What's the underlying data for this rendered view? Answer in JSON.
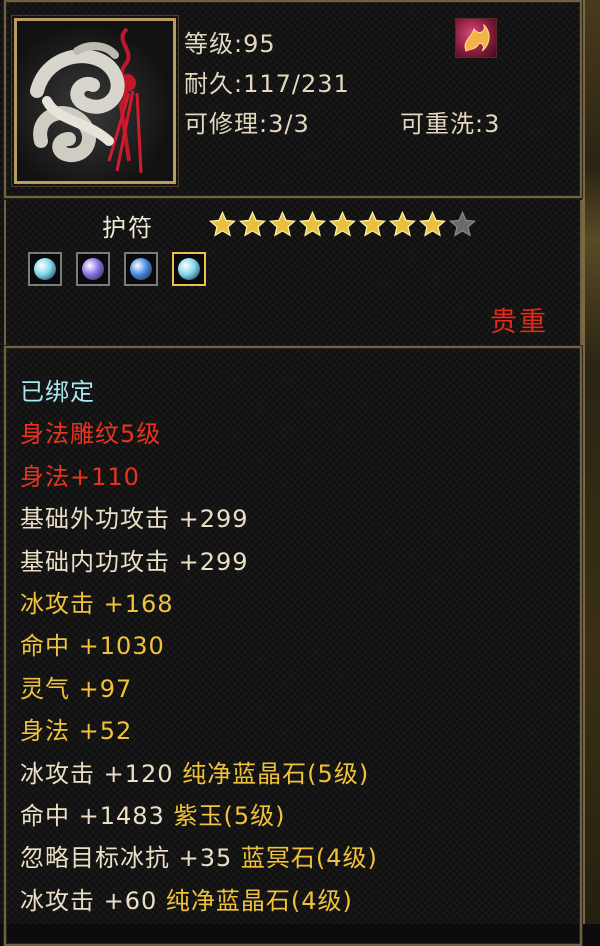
{
  "header": {
    "level": "等级:95",
    "durability": "耐久:117/231",
    "repairable": "可修理:3/3",
    "rewash": "可重洗:3"
  },
  "item": {
    "name": "护符",
    "stars_filled": 8,
    "stars_total": 9,
    "rarity": "贵重",
    "badge_icon": "flame-icon",
    "portrait_icon": "jade-amulet-icon"
  },
  "gems": [
    {
      "icon": "cyan-gem-icon",
      "color": "#7fd6e8",
      "selected": false
    },
    {
      "icon": "purple-gem-icon",
      "color": "#8a70e0",
      "selected": false
    },
    {
      "icon": "blue-gem-icon",
      "color": "#4a88e0",
      "selected": false
    },
    {
      "icon": "cyan-gem-icon",
      "color": "#7fd6e8",
      "selected": true
    }
  ],
  "attributes": [
    {
      "text": "已绑定",
      "style": "bound"
    },
    {
      "text": "身法雕纹5级",
      "style": "red"
    },
    {
      "text": "身法+110",
      "style": "red"
    },
    {
      "text": "基础外功攻击 +299",
      "style": "base"
    },
    {
      "text": "基础内功攻击 +299",
      "style": "base"
    },
    {
      "text": "冰攻击 +168",
      "style": "gold"
    },
    {
      "text": "命中 +1030",
      "style": "gold"
    },
    {
      "text": "灵气 +97",
      "style": "gold"
    },
    {
      "text": "身法 +52",
      "style": "gold"
    }
  ],
  "gem_attributes": [
    {
      "stat": "冰攻击 +120 ",
      "gem": "纯净蓝晶石(5级)"
    },
    {
      "stat": "命中 +1483 ",
      "gem": "紫玉(5级)"
    },
    {
      "stat": "忽略目标冰抗 +35 ",
      "gem": "蓝冥石(4级)"
    },
    {
      "stat": "冰攻击 +60 ",
      "gem": "纯净蓝晶石(4级)"
    }
  ],
  "colors": {
    "frame": "#6e6146",
    "bound": "#a8e7f0",
    "red": "#e8341f",
    "gold": "#f0c23a",
    "base": "#eadfc4",
    "rarity": "#e02b1b"
  }
}
